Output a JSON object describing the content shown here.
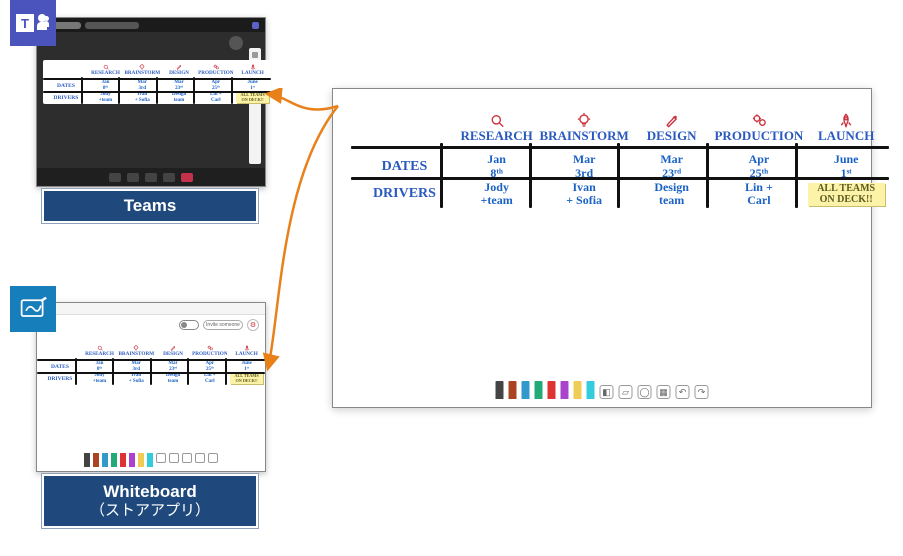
{
  "labels": {
    "teams": "Teams",
    "whiteboard_title": "Whiteboard",
    "whiteboard_sub": "（ストアアプリ）"
  },
  "board": {
    "columns": [
      {
        "id": "research",
        "label": "RESEARCH",
        "icon": "magnifier-icon",
        "date_line1": "Jan",
        "date_line2": "8ᵗʰ",
        "driver_line1": "Jody",
        "driver_line2": "+team"
      },
      {
        "id": "brainstorm",
        "label": "BRAINSTORM",
        "icon": "lightbulb-icon",
        "date_line1": "Mar",
        "date_line2": "3rd",
        "driver_line1": "Ivan",
        "driver_line2": "+ Sofia"
      },
      {
        "id": "design",
        "label": "DESIGN",
        "icon": "paintbrush-icon",
        "date_line1": "Mar",
        "date_line2": "23ʳᵈ",
        "driver_line1": "Design",
        "driver_line2": "team"
      },
      {
        "id": "production",
        "label": "PRODUCTION",
        "icon": "gears-icon",
        "date_line1": "Apr",
        "date_line2": "25ᵗʰ",
        "driver_line1": "Lin +",
        "driver_line2": "Carl"
      },
      {
        "id": "launch",
        "label": "LAUNCH",
        "icon": "rocket-icon",
        "date_line1": "June",
        "date_line2": "1ˢᵗ",
        "driver_line1": "",
        "driver_line2": ""
      }
    ],
    "row_labels": {
      "dates": "DATES",
      "drivers": "DRIVERS"
    },
    "sticky": "ALL TEAMS ON DECK!!"
  },
  "toolbar_whiteboard": {
    "invite": "Invite someone"
  }
}
